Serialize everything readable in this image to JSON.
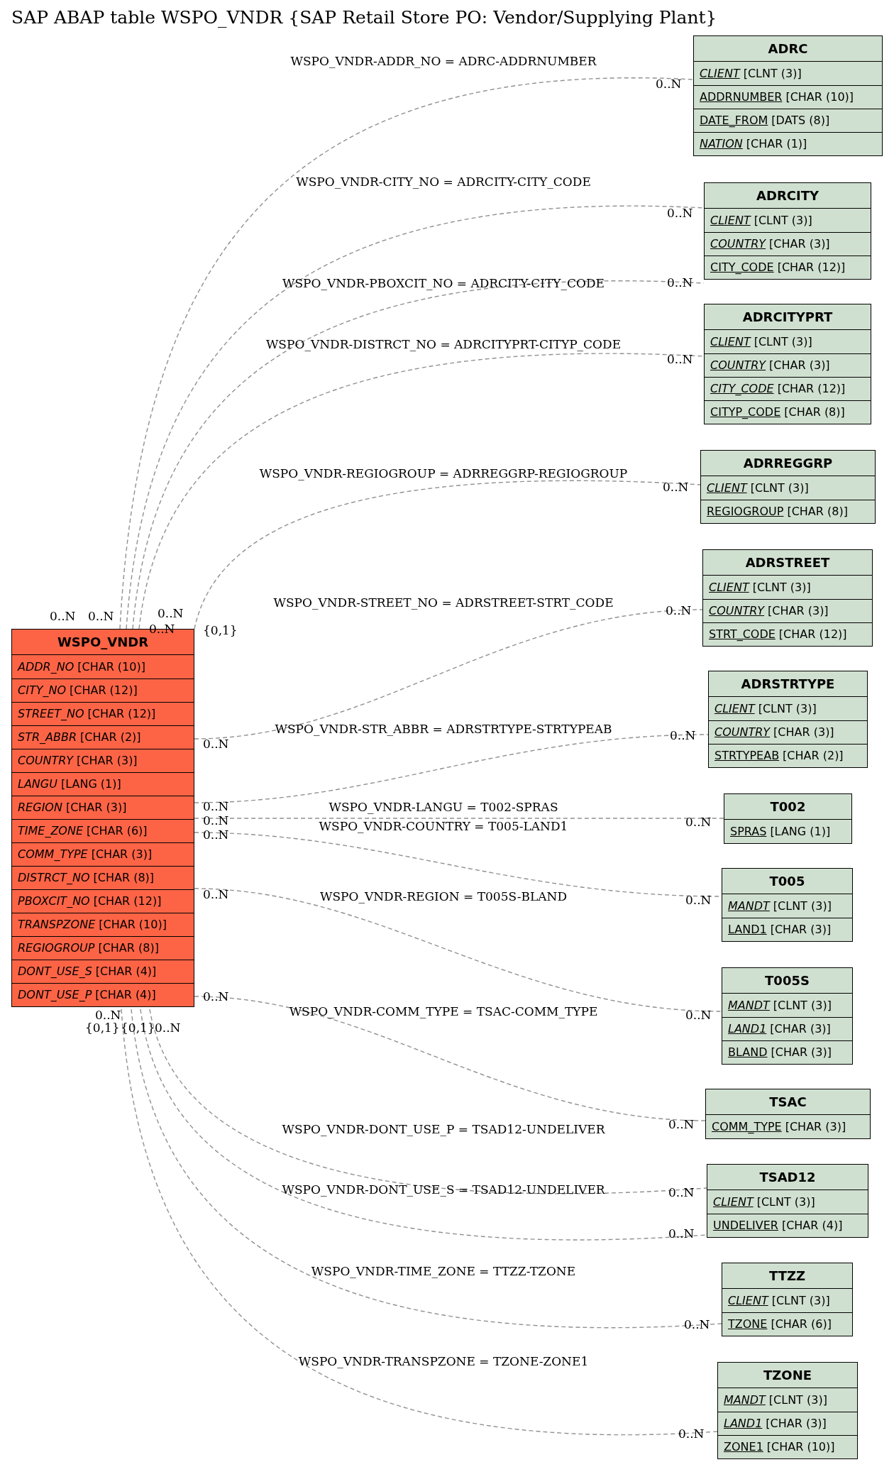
{
  "title": "SAP ABAP table WSPO_VNDR {SAP Retail Store PO: Vendor/Supplying Plant}",
  "main_table": {
    "name": "WSPO_VNDR",
    "fields": [
      {
        "name": "ADDR_NO",
        "type": "[CHAR (10)]",
        "key": false,
        "foreign": true
      },
      {
        "name": "CITY_NO",
        "type": "[CHAR (12)]",
        "key": false,
        "foreign": true
      },
      {
        "name": "STREET_NO",
        "type": "[CHAR (12)]",
        "key": false,
        "foreign": true
      },
      {
        "name": "STR_ABBR",
        "type": "[CHAR (2)]",
        "key": false,
        "foreign": true
      },
      {
        "name": "COUNTRY",
        "type": "[CHAR (3)]",
        "key": false,
        "foreign": true
      },
      {
        "name": "LANGU",
        "type": "[LANG (1)]",
        "key": false,
        "foreign": true
      },
      {
        "name": "REGION",
        "type": "[CHAR (3)]",
        "key": false,
        "foreign": true
      },
      {
        "name": "TIME_ZONE",
        "type": "[CHAR (6)]",
        "key": false,
        "foreign": true
      },
      {
        "name": "COMM_TYPE",
        "type": "[CHAR (3)]",
        "key": false,
        "foreign": true
      },
      {
        "name": "DISTRCT_NO",
        "type": "[CHAR (8)]",
        "key": false,
        "foreign": true
      },
      {
        "name": "PBOXCIT_NO",
        "type": "[CHAR (12)]",
        "key": false,
        "foreign": true
      },
      {
        "name": "TRANSPZONE",
        "type": "[CHAR (10)]",
        "key": false,
        "foreign": true
      },
      {
        "name": "REGIOGROUP",
        "type": "[CHAR (8)]",
        "key": false,
        "foreign": true
      },
      {
        "name": "DONT_USE_S",
        "type": "[CHAR (4)]",
        "key": false,
        "foreign": true
      },
      {
        "name": "DONT_USE_P",
        "type": "[CHAR (4)]",
        "key": false,
        "foreign": true
      }
    ]
  },
  "tables": [
    {
      "name": "ADRC",
      "fields": [
        {
          "name": "CLIENT",
          "type": "[CLNT (3)]",
          "key": true,
          "foreign": true
        },
        {
          "name": "ADDRNUMBER",
          "type": "[CHAR (10)]",
          "key": true,
          "foreign": false
        },
        {
          "name": "DATE_FROM",
          "type": "[DATS (8)]",
          "key": true,
          "foreign": false
        },
        {
          "name": "NATION",
          "type": "[CHAR (1)]",
          "key": true,
          "foreign": true
        }
      ]
    },
    {
      "name": "ADRCITY",
      "fields": [
        {
          "name": "CLIENT",
          "type": "[CLNT (3)]",
          "key": true,
          "foreign": true
        },
        {
          "name": "COUNTRY",
          "type": "[CHAR (3)]",
          "key": true,
          "foreign": true
        },
        {
          "name": "CITY_CODE",
          "type": "[CHAR (12)]",
          "key": true,
          "foreign": false
        }
      ]
    },
    {
      "name": "ADRCITYPRT",
      "fields": [
        {
          "name": "CLIENT",
          "type": "[CLNT (3)]",
          "key": true,
          "foreign": true
        },
        {
          "name": "COUNTRY",
          "type": "[CHAR (3)]",
          "key": true,
          "foreign": true
        },
        {
          "name": "CITY_CODE",
          "type": "[CHAR (12)]",
          "key": true,
          "foreign": true
        },
        {
          "name": "CITYP_CODE",
          "type": "[CHAR (8)]",
          "key": true,
          "foreign": false
        }
      ]
    },
    {
      "name": "ADRREGGRP",
      "fields": [
        {
          "name": "CLIENT",
          "type": "[CLNT (3)]",
          "key": true,
          "foreign": true
        },
        {
          "name": "REGIOGROUP",
          "type": "[CHAR (8)]",
          "key": true,
          "foreign": false
        }
      ]
    },
    {
      "name": "ADRSTREET",
      "fields": [
        {
          "name": "CLIENT",
          "type": "[CLNT (3)]",
          "key": true,
          "foreign": true
        },
        {
          "name": "COUNTRY",
          "type": "[CHAR (3)]",
          "key": true,
          "foreign": true
        },
        {
          "name": "STRT_CODE",
          "type": "[CHAR (12)]",
          "key": true,
          "foreign": false
        }
      ]
    },
    {
      "name": "ADRSTRTYPE",
      "fields": [
        {
          "name": "CLIENT",
          "type": "[CLNT (3)]",
          "key": true,
          "foreign": true
        },
        {
          "name": "COUNTRY",
          "type": "[CHAR (3)]",
          "key": true,
          "foreign": true
        },
        {
          "name": "STRTYPEAB",
          "type": "[CHAR (2)]",
          "key": true,
          "foreign": false
        }
      ]
    },
    {
      "name": "T002",
      "fields": [
        {
          "name": "SPRAS",
          "type": "[LANG (1)]",
          "key": true,
          "foreign": false
        }
      ]
    },
    {
      "name": "T005",
      "fields": [
        {
          "name": "MANDT",
          "type": "[CLNT (3)]",
          "key": true,
          "foreign": true
        },
        {
          "name": "LAND1",
          "type": "[CHAR (3)]",
          "key": true,
          "foreign": false
        }
      ]
    },
    {
      "name": "T005S",
      "fields": [
        {
          "name": "MANDT",
          "type": "[CLNT (3)]",
          "key": true,
          "foreign": true
        },
        {
          "name": "LAND1",
          "type": "[CHAR (3)]",
          "key": true,
          "foreign": true
        },
        {
          "name": "BLAND",
          "type": "[CHAR (3)]",
          "key": true,
          "foreign": false
        }
      ]
    },
    {
      "name": "TSAC",
      "fields": [
        {
          "name": "COMM_TYPE",
          "type": "[CHAR (3)]",
          "key": true,
          "foreign": false
        }
      ]
    },
    {
      "name": "TSAD12",
      "fields": [
        {
          "name": "CLIENT",
          "type": "[CLNT (3)]",
          "key": true,
          "foreign": true
        },
        {
          "name": "UNDELIVER",
          "type": "[CHAR (4)]",
          "key": true,
          "foreign": false
        }
      ]
    },
    {
      "name": "TTZZ",
      "fields": [
        {
          "name": "CLIENT",
          "type": "[CLNT (3)]",
          "key": true,
          "foreign": true
        },
        {
          "name": "TZONE",
          "type": "[CHAR (6)]",
          "key": true,
          "foreign": false
        }
      ]
    },
    {
      "name": "TZONE",
      "fields": [
        {
          "name": "MANDT",
          "type": "[CLNT (3)]",
          "key": true,
          "foreign": true
        },
        {
          "name": "LAND1",
          "type": "[CHAR (3)]",
          "key": true,
          "foreign": true
        },
        {
          "name": "ZONE1",
          "type": "[CHAR (10)]",
          "key": true,
          "foreign": false
        }
      ]
    }
  ],
  "relations": [
    {
      "label": "WSPO_VNDR-ADDR_NO = ADRC-ADDRNUMBER",
      "source_card": "0..N",
      "target_card": "0..N"
    },
    {
      "label": "WSPO_VNDR-CITY_NO = ADRCITY-CITY_CODE",
      "source_card": "0..N",
      "target_card": "0..N"
    },
    {
      "label": "WSPO_VNDR-PBOXCIT_NO = ADRCITY-CITY_CODE",
      "source_card": "0..N",
      "target_card": "0..N"
    },
    {
      "label": "WSPO_VNDR-DISTRCT_NO = ADRCITYPRT-CITYP_CODE",
      "source_card": "0..N",
      "target_card": "0..N"
    },
    {
      "label": "WSPO_VNDR-REGIOGROUP = ADRREGGRP-REGIOGROUP",
      "source_card": "{0,1}",
      "target_card": "0..N"
    },
    {
      "label": "WSPO_VNDR-STREET_NO = ADRSTREET-STRT_CODE",
      "source_card": "0..N",
      "target_card": "0..N"
    },
    {
      "label": "WSPO_VNDR-STR_ABBR = ADRSTRTYPE-STRTYPEAB",
      "source_card": "0..N",
      "target_card": "0..N"
    },
    {
      "label": "WSPO_VNDR-LANGU = T002-SPRAS",
      "source_card": "0..N",
      "target_card": "0..N"
    },
    {
      "label": "WSPO_VNDR-COUNTRY = T005-LAND1",
      "source_card": "0..N",
      "target_card": "0..N"
    },
    {
      "label": "WSPO_VNDR-REGION = T005S-BLAND",
      "source_card": "0..N",
      "target_card": "0..N"
    },
    {
      "label": "WSPO_VNDR-COMM_TYPE = TSAC-COMM_TYPE",
      "source_card": "0..N",
      "target_card": "0..N"
    },
    {
      "label": "WSPO_VNDR-DONT_USE_P = TSAD12-UNDELIVER",
      "source_card": "0..N",
      "target_card": "0..N"
    },
    {
      "label": "WSPO_VNDR-DONT_USE_S = TSAD12-UNDELIVER",
      "source_card": "{0,1}",
      "target_card": "0..N"
    },
    {
      "label": "WSPO_VNDR-TIME_ZONE = TTZZ-TZONE",
      "source_card": "{0,1}",
      "target_card": "0..N"
    },
    {
      "label": "WSPO_VNDR-TRANSPZONE = TZONE-ZONE1",
      "source_card": "0..N",
      "target_card": "0..N"
    }
  ]
}
